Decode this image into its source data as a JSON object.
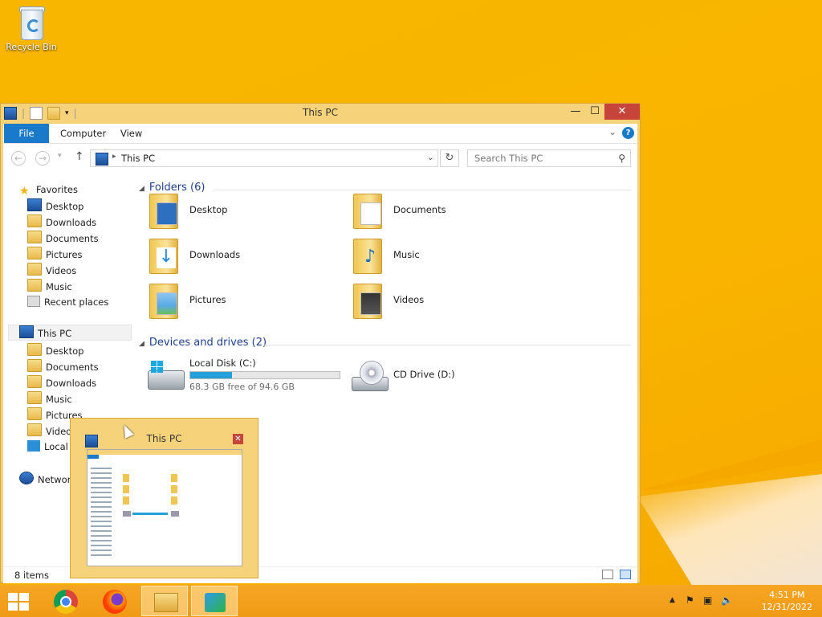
{
  "desktop": {
    "recycle_bin": "Recycle Bin"
  },
  "window": {
    "title": "This PC",
    "controls": {
      "minimize": "—",
      "maximize": "☐",
      "close": "✕"
    },
    "ribbon_tabs": [
      "File",
      "Computer",
      "View"
    ],
    "address": "This PC",
    "search_placeholder": "Search This PC",
    "nav": {
      "favorites_header": "Favorites",
      "favorites": [
        "Desktop",
        "Downloads",
        "Documents",
        "Pictures",
        "Videos",
        "Music",
        "Recent places"
      ],
      "this_pc": "This PC",
      "this_pc_items": [
        "Desktop",
        "Documents",
        "Downloads",
        "Music",
        "Pictures",
        "Videos",
        "Local"
      ],
      "network": "Network"
    },
    "folders_header": "Folders (6)",
    "folders": [
      "Desktop",
      "Documents",
      "Downloads",
      "Music",
      "Pictures",
      "Videos"
    ],
    "drives_header": "Devices and drives (2)",
    "drives": [
      {
        "name": "Local Disk (C:)",
        "free": "68.3 GB free of 94.6 GB",
        "used_fraction": 0.278
      },
      {
        "name": "CD Drive (D:)"
      }
    ],
    "status": "8 items"
  },
  "preview": {
    "title": "This PC",
    "close": "✕"
  },
  "taskbar": {
    "time": "4:51 PM",
    "date": "12/31/2022"
  },
  "colors": {
    "accent": "#1979ca",
    "close": "#c7443a",
    "wallpaper": "#f8b600"
  }
}
